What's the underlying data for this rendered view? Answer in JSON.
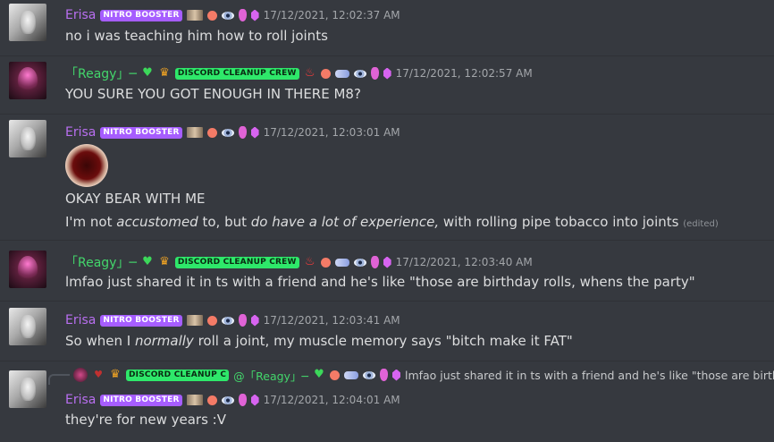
{
  "users": {
    "erisa": {
      "name": "Erisa",
      "badge": "NITRO BOOSTER",
      "color": "#b96ff0"
    },
    "reagy": {
      "name": "「Reagy」─",
      "badge": "DISCORD CLEANUP CREW",
      "color": "#43d66b"
    }
  },
  "messages": [
    {
      "author": "Erisa",
      "badge": "NITRO BOOSTER",
      "timestamp": "17/12/2021, 12:02:37 AM",
      "text": "no i was teaching him how to roll joints"
    },
    {
      "author": "「Reagy」─",
      "badge": "DISCORD CLEANUP CREW",
      "timestamp": "17/12/2021, 12:02:57 AM",
      "text": "YOU SURE YOU GOT ENOUGH IN THERE M8?"
    },
    {
      "author": "Erisa",
      "badge": "NITRO BOOSTER",
      "timestamp": "17/12/2021, 12:03:01 AM",
      "line1": "OKAY BEAR WITH ME",
      "line2_a": "I'm not ",
      "line2_em1": "accustomed",
      "line2_b": " to, but ",
      "line2_em2": "do have a lot of experience,",
      "line2_c": " with rolling pipe tobacco into joints ",
      "edited": "(edited)"
    },
    {
      "author": "「Reagy」─",
      "badge": "DISCORD CLEANUP CREW",
      "timestamp": "17/12/2021, 12:03:40 AM",
      "text": "lmfao just shared it in ts with a friend and he's like \"those are birthday rolls, whens the party\""
    },
    {
      "author": "Erisa",
      "badge": "NITRO BOOSTER",
      "timestamp": "17/12/2021, 12:03:41 AM",
      "text_a": "So when I ",
      "text_em": "normally",
      "text_b": " roll a joint, my muscle memory says \"bitch make it FAT\""
    },
    {
      "author": "Erisa",
      "badge": "NITRO BOOSTER",
      "timestamp": "17/12/2021, 12:04:01 AM",
      "text": "they're for new years :V",
      "reply": {
        "badge": "DISCORD CLEANUP C",
        "mention": "@「Reagy」─",
        "text": "lmfao just shared it in ts with a friend and he's like \"those are birthd..."
      }
    }
  ]
}
